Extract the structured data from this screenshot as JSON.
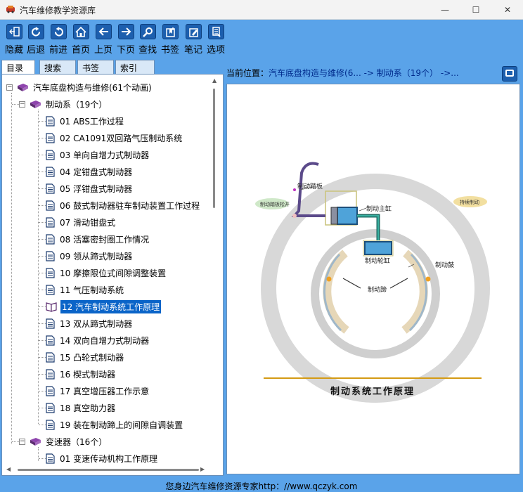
{
  "window": {
    "title": "汽车维修教学资源库",
    "minimize": "—",
    "maximize": "☐",
    "close": "✕"
  },
  "toolbar": {
    "buttons": [
      {
        "label": "隐藏",
        "icon": "hide-icon"
      },
      {
        "label": "后退",
        "icon": "back-icon"
      },
      {
        "label": "前进",
        "icon": "forward-icon"
      },
      {
        "label": "首页",
        "icon": "home-icon"
      },
      {
        "label": "上页",
        "icon": "prev-page-icon"
      },
      {
        "label": "下页",
        "icon": "next-page-icon"
      },
      {
        "label": "查找",
        "icon": "find-icon"
      },
      {
        "label": "书签",
        "icon": "bookmark-icon"
      },
      {
        "label": "笔记",
        "icon": "note-icon"
      },
      {
        "label": "选项",
        "icon": "options-icon"
      }
    ]
  },
  "tabs": [
    "目录",
    "搜索",
    "书签",
    "索引"
  ],
  "tree": {
    "root": "汽车底盘构造与维修(61个动画)",
    "group1": "制动系（19个）",
    "items": [
      "01 ABS工作过程",
      "02 CA1091双回路气压制动系统",
      "03 单向自增力式制动器",
      "04 定钳盘式制动器",
      "05 浮钳盘式制动器",
      "06 鼓式制动器驻车制动装置工作过程",
      "07 滑动钳盘式",
      "08 活塞密封圈工作情况",
      "09 领从蹄式制动器",
      "10 摩擦限位式间隙调整装置",
      "11 气压制动系统",
      "12 汽车制动系统工作原理",
      "13 双从蹄式制动器",
      "14 双向自增力式制动器",
      "15 凸轮式制动器",
      "16 楔式制动器",
      "17 真空增压器工作示意",
      "18 真空助力器",
      "19 装在制动蹄上的间隙自调装置"
    ],
    "selected_index": 11,
    "group2": "变速器（16个）",
    "group2_items": [
      "01 变速传动机构工作原理"
    ]
  },
  "breadcrumb": {
    "prefix": "当前位置：",
    "path": "汽车底盘构造与维修(6... -> 制动系（19个） ->..."
  },
  "diagram": {
    "caption": "制动系统工作原理",
    "labels": {
      "pedal": "制动踏板",
      "master": "制动主缸",
      "wheel": "制动轮缸",
      "drum": "制动鼓",
      "shoe": "制动蹄",
      "release": "制动踏板松开",
      "continue": "持续制动"
    }
  },
  "status": "您身边汽车维修资源专家http：//www.qczyk.com",
  "colors": {
    "accent": "#5aa3e9",
    "selection": "#0a64c8",
    "icon_blue": "#1d5fae"
  }
}
